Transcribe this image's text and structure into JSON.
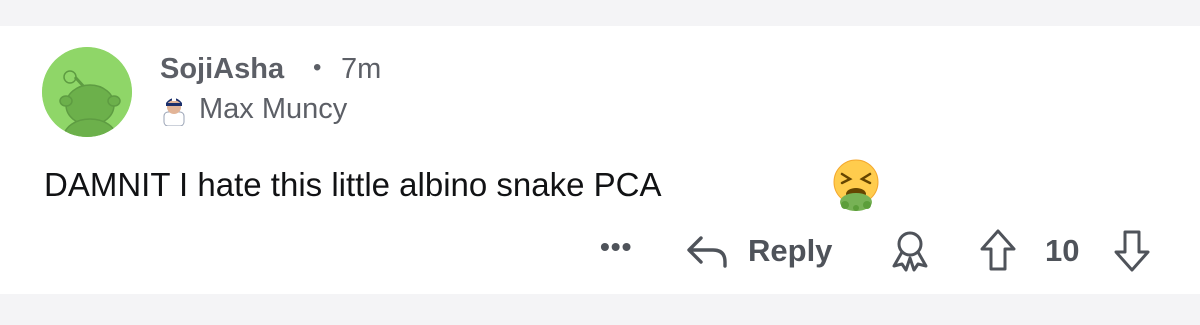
{
  "comment": {
    "author": "SojiAsha",
    "separator": "•",
    "age": "7m",
    "flair": "Max Muncy",
    "body": "DAMNIT I hate this little albino snake PCA",
    "emoji": "nauseated-vomiting-face"
  },
  "actions": {
    "more_label": "•••",
    "reply_label": "Reply",
    "vote_count": "10"
  },
  "icons": {
    "avatar": "snoo-avatar-icon",
    "more": "more-options-icon",
    "reply": "reply-arrow-icon",
    "award": "award-icon",
    "upvote": "upvote-arrow-icon",
    "downvote": "downvote-arrow-icon"
  },
  "colors": {
    "avatar_bg": "#8fd668",
    "meta_text": "#5c5f66",
    "body_text": "#111214",
    "action_text": "#4f535a"
  }
}
